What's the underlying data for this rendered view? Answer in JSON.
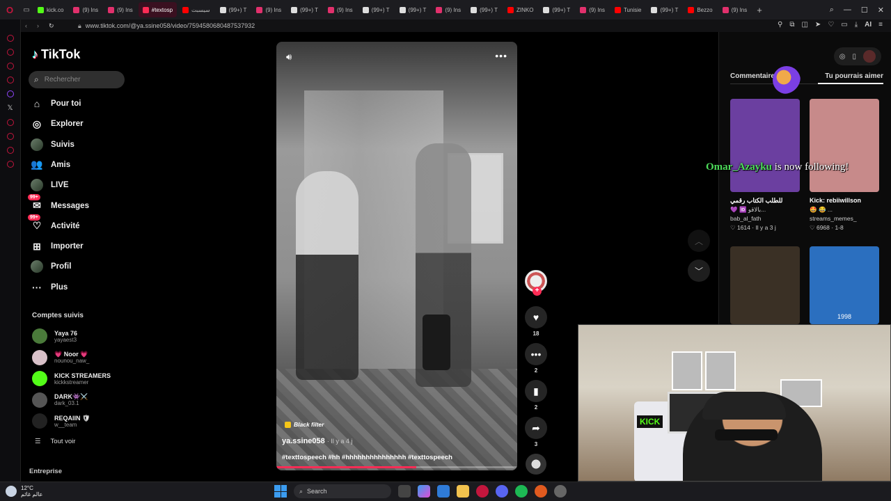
{
  "browser": {
    "tabs": [
      {
        "label": "kick.co",
        "color": "#53fc18"
      },
      {
        "label": "(9) Ins",
        "color": "#e1306c"
      },
      {
        "label": "(9) Ins",
        "color": "#e1306c"
      },
      {
        "label": "#textosp",
        "color": "#fe2c55",
        "active": true
      },
      {
        "label": "سيسبت",
        "color": "#ff0000"
      },
      {
        "label": "(99+) T",
        "color": "#dddddd"
      },
      {
        "label": "(9) Ins",
        "color": "#e1306c"
      },
      {
        "label": "(99+) T",
        "color": "#dddddd"
      },
      {
        "label": "(9) Ins",
        "color": "#e1306c"
      },
      {
        "label": "(99+) T",
        "color": "#dddddd"
      },
      {
        "label": "(99+) T",
        "color": "#dddddd"
      },
      {
        "label": "(9) Ins",
        "color": "#e1306c"
      },
      {
        "label": "(99+) T",
        "color": "#dddddd"
      },
      {
        "label": "ZINKO",
        "color": "#ff0000"
      },
      {
        "label": "(99+) T",
        "color": "#dddddd"
      },
      {
        "label": "(9) Ins",
        "color": "#e1306c"
      },
      {
        "label": "Tunisie",
        "color": "#ff0000"
      },
      {
        "label": "(99+) T",
        "color": "#dddddd"
      },
      {
        "label": "Bezzo",
        "color": "#ff0000"
      },
      {
        "label": "(9) Ins",
        "color": "#e1306c"
      }
    ],
    "new_tab": "+",
    "url": "www.tiktok.com/@ya.ssine058/video/7594580680487537932",
    "ai_label": "AI"
  },
  "sidebar": {
    "brand": "TikTok",
    "search_placeholder": "Rechercher",
    "nav": [
      {
        "label": "Pour toi",
        "icon": "home-icon",
        "glyph": "⌂"
      },
      {
        "label": "Explorer",
        "icon": "compass-icon",
        "glyph": "◎"
      },
      {
        "label": "Suivis",
        "icon": "avatar",
        "glyph": ""
      },
      {
        "label": "Amis",
        "icon": "friends-icon",
        "glyph": "👥"
      },
      {
        "label": "LIVE",
        "icon": "avatar",
        "glyph": ""
      },
      {
        "label": "Messages",
        "icon": "message-icon",
        "glyph": "✉",
        "badge": "99+"
      },
      {
        "label": "Activité",
        "icon": "activity-icon",
        "glyph": "♡",
        "badge": "99+"
      },
      {
        "label": "Importer",
        "icon": "upload-icon",
        "glyph": "⊞"
      },
      {
        "label": "Profil",
        "icon": "avatar",
        "glyph": ""
      },
      {
        "label": "Plus",
        "icon": "more-icon",
        "glyph": "···"
      }
    ],
    "following_title": "Comptes suivis",
    "accounts": [
      {
        "name": "Yaya 76",
        "handle": "yayaest3",
        "color": "#4a7a3a"
      },
      {
        "name": "💗 Noor 💗",
        "handle": "nounou_naw_",
        "color": "#d8c0c8"
      },
      {
        "name": "KICK STREAMERS",
        "handle": "kickkstreamer",
        "color": "#53fc18"
      },
      {
        "name": "DARK👾⚔️",
        "handle": "dark_03.1",
        "color": "#555555"
      },
      {
        "name": "REQAIIN 🛡",
        "handle": "w__team",
        "color": "#222222"
      }
    ],
    "see_all": "Tout voir",
    "enterprise": "Entreprise"
  },
  "video": {
    "filter": "Black filter",
    "author": "ya.ssine058",
    "ago": "· Il y a 4 j",
    "tags": "#texttospeech #hh #hhhhhhhhhhhhhhh #texttospeech",
    "progress": 0.58
  },
  "actions": {
    "likes": "18",
    "comments": "2",
    "saves": "2",
    "shares": "3"
  },
  "right_panel": {
    "tab_comments": "Commentaires",
    "tab_suggested": "Tu pourrais aimer",
    "cards": [
      {
        "title": "للطلب الكتاب رقمي",
        "subtitle": "💜 🆔 بالاقو...",
        "author": "bab_al_fath",
        "stats": "♡ 1614 · Il y a 3 j",
        "bg": "#6b3fa0"
      },
      {
        "title": "Kick: rebiiwillson",
        "subtitle": "🤩 😂 ...",
        "author": "streams_memes_",
        "stats": "♡ 6968 · 1-8",
        "bg": "#c78a8a"
      },
      {
        "title": "",
        "subtitle": "",
        "author": "",
        "stats": "",
        "bg": "#3a3025"
      },
      {
        "title": "",
        "subtitle": "",
        "author": "",
        "stats": "",
        "bg": "#2b6fbf",
        "overlay": "1998"
      }
    ]
  },
  "stream_overlay": {
    "name": "Omar_Azayku",
    "text": " is now following!"
  },
  "webcam": {
    "kick_sign": "KICK"
  },
  "taskbar": {
    "temp": "12°C",
    "weather_label": "عالم غائم",
    "search": "Search"
  }
}
